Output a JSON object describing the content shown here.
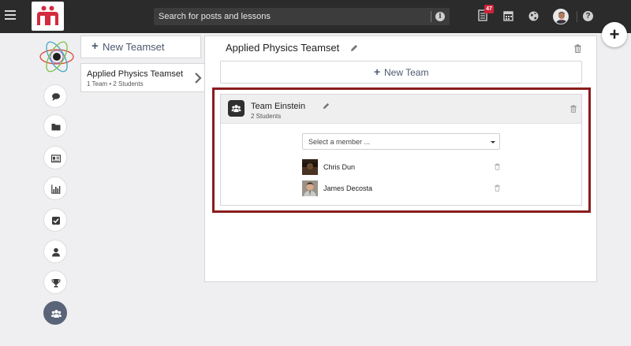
{
  "topbar": {
    "search": {
      "placeholder": "Search for posts and lessons"
    },
    "notifications": {
      "count": "47"
    },
    "help_label": "?",
    "info_label": "i",
    "colors": {
      "bar": "#2b2b2b",
      "badge": "#d0223a",
      "logo": "#d32a3d"
    }
  },
  "fab": {
    "label": "+"
  },
  "sidebar": {
    "items": [
      {
        "icon": "chat-bubble-icon"
      },
      {
        "icon": "folder-icon"
      },
      {
        "icon": "id-card-icon"
      },
      {
        "icon": "bar-chart-icon"
      },
      {
        "icon": "checkbox-icon"
      },
      {
        "icon": "user-icon"
      },
      {
        "icon": "trophy-icon"
      },
      {
        "icon": "group-icon",
        "active": true
      }
    ]
  },
  "teamsets": {
    "new_button": {
      "plus": "+",
      "label": "New Teamset"
    },
    "items": [
      {
        "title": "Applied Physics Teamset",
        "subtitle": "1 Team • 2 Students"
      }
    ]
  },
  "main": {
    "title": "Applied Physics Teamset",
    "new_team": {
      "plus": "+",
      "label": "New Team"
    },
    "team": {
      "name": "Team Einstein",
      "subtitle": "2 Students",
      "member_select": {
        "placeholder": "Select a member ..."
      },
      "members": [
        {
          "name": "Chris Dun"
        },
        {
          "name": "James Decosta"
        }
      ]
    }
  },
  "highlight_color": "#8b1c1c"
}
